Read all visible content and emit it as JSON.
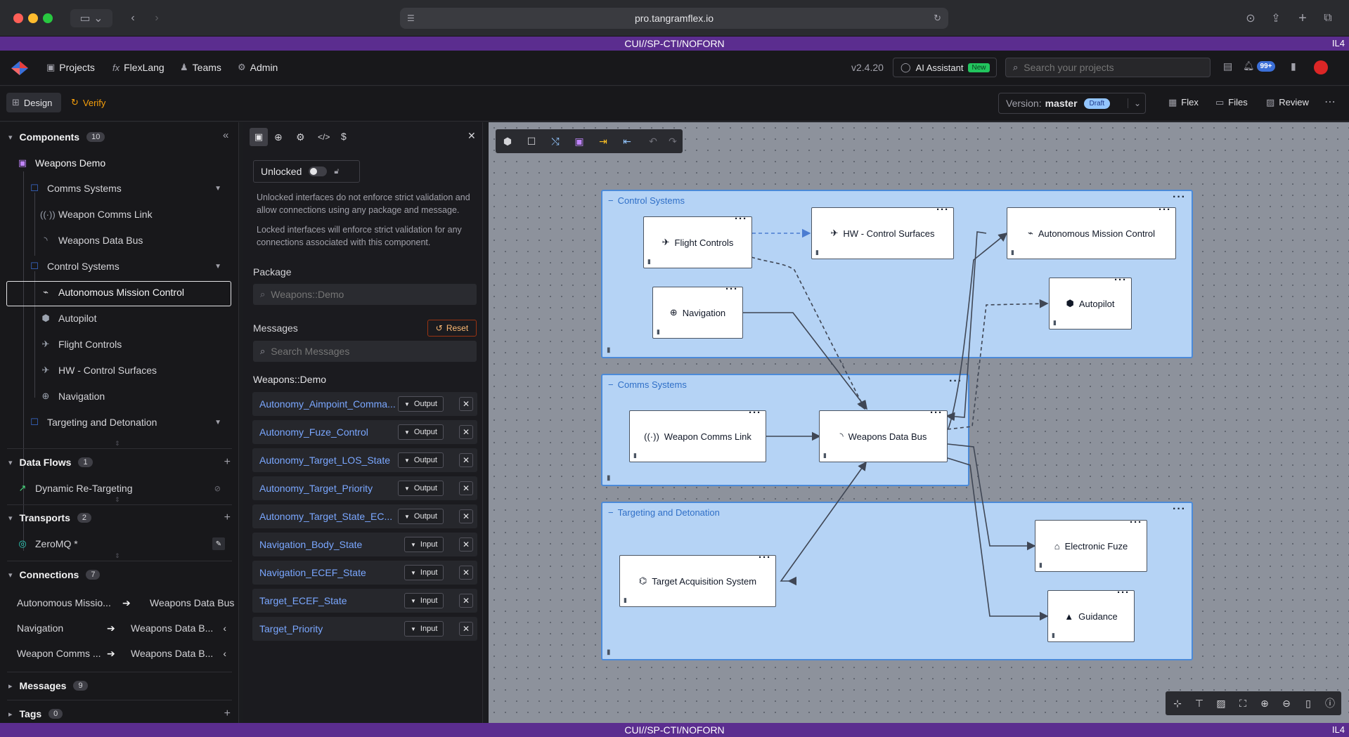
{
  "browser": {
    "url": "pro.tangramflex.io"
  },
  "banner": {
    "text": "CUI//SP-CTI/NOFORN",
    "level": "IL4"
  },
  "header": {
    "nav": [
      "Projects",
      "FlexLang",
      "Teams",
      "Admin"
    ],
    "version": "v2.4.20",
    "ai_label": "AI Assistant",
    "ai_badge": "New",
    "search_placeholder": "Search your projects",
    "notif_count": "99+"
  },
  "subheader": {
    "design": "Design",
    "verify": "Verify",
    "version_label": "Version:",
    "version_name": "master",
    "draft": "Draft",
    "flex": "Flex",
    "files": "Files",
    "review": "Review"
  },
  "left": {
    "components_title": "Components",
    "components_count": "10",
    "project": "Weapons Demo",
    "tree": [
      {
        "label": "Comms Systems",
        "icon": "square-icon",
        "level": 1,
        "group": true
      },
      {
        "label": "Weapon Comms Link",
        "icon": "antenna-icon",
        "level": 2
      },
      {
        "label": "Weapons Data Bus",
        "icon": "rss-icon",
        "level": 2
      },
      {
        "label": "Control Systems",
        "icon": "square-icon",
        "level": 1,
        "group": true
      },
      {
        "label": "Autonomous Mission Control",
        "icon": "satellite-icon",
        "level": 2,
        "selected": true
      },
      {
        "label": "Autopilot",
        "icon": "cube-icon",
        "level": 2
      },
      {
        "label": "Flight Controls",
        "icon": "plane-icon",
        "level": 2
      },
      {
        "label": "HW - Control Surfaces",
        "icon": "plane-icon",
        "level": 2
      },
      {
        "label": "Navigation",
        "icon": "globe-icon",
        "level": 2
      },
      {
        "label": "Targeting and Detonation",
        "icon": "square-icon",
        "level": 1,
        "group": true
      }
    ],
    "dataflows_title": "Data Flows",
    "dataflows_count": "1",
    "dataflow": "Dynamic Re-Targeting",
    "transports_title": "Transports",
    "transports_count": "2",
    "transport": "ZeroMQ *",
    "connections_title": "Connections",
    "connections_count": "7",
    "connections": [
      {
        "from": "Autonomous Missio...",
        "to": "Weapons Data Bus"
      },
      {
        "from": "Navigation",
        "to": "Weapons Data B..."
      },
      {
        "from": "Weapon Comms ...",
        "to": "Weapons Data B..."
      }
    ],
    "messages_title": "Messages",
    "messages_count": "9",
    "tags_title": "Tags",
    "tags_count": "0"
  },
  "mid": {
    "lock_label": "Unlocked",
    "unlocked_desc": "Unlocked interfaces do not enforce strict validation and allow connections using any package and message.",
    "locked_desc": "Locked interfaces will enforce strict validation for any connections associated with this component.",
    "package_label": "Package",
    "package_placeholder": "Weapons::Demo",
    "messages_label": "Messages",
    "reset": "Reset",
    "search_placeholder": "Search Messages",
    "package_name": "Weapons::Demo",
    "messages": [
      {
        "name": "Autonomy_Aimpoint_Comma...",
        "dir": "Output"
      },
      {
        "name": "Autonomy_Fuze_Control",
        "dir": "Output"
      },
      {
        "name": "Autonomy_Target_LOS_State",
        "dir": "Output"
      },
      {
        "name": "Autonomy_Target_Priority",
        "dir": "Output"
      },
      {
        "name": "Autonomy_Target_State_EC...",
        "dir": "Output"
      },
      {
        "name": "Navigation_Body_State",
        "dir": "Input"
      },
      {
        "name": "Navigation_ECEF_State",
        "dir": "Input"
      },
      {
        "name": "Target_ECEF_State",
        "dir": "Input"
      },
      {
        "name": "Target_Priority",
        "dir": "Input"
      }
    ]
  },
  "canvas": {
    "groups": [
      "Control Systems",
      "Comms Systems",
      "Targeting and Detonation"
    ],
    "nodes": {
      "flight": "Flight Controls",
      "hw": "HW - Control Surfaces",
      "amc": "Autonomous Mission Control",
      "nav": "Navigation",
      "autopilot": "Autopilot",
      "wcl": "Weapon Comms Link",
      "wdb": "Weapons Data Bus",
      "tas": "Target Acquisition System",
      "fuze": "Electronic Fuze",
      "guidance": "Guidance"
    }
  }
}
